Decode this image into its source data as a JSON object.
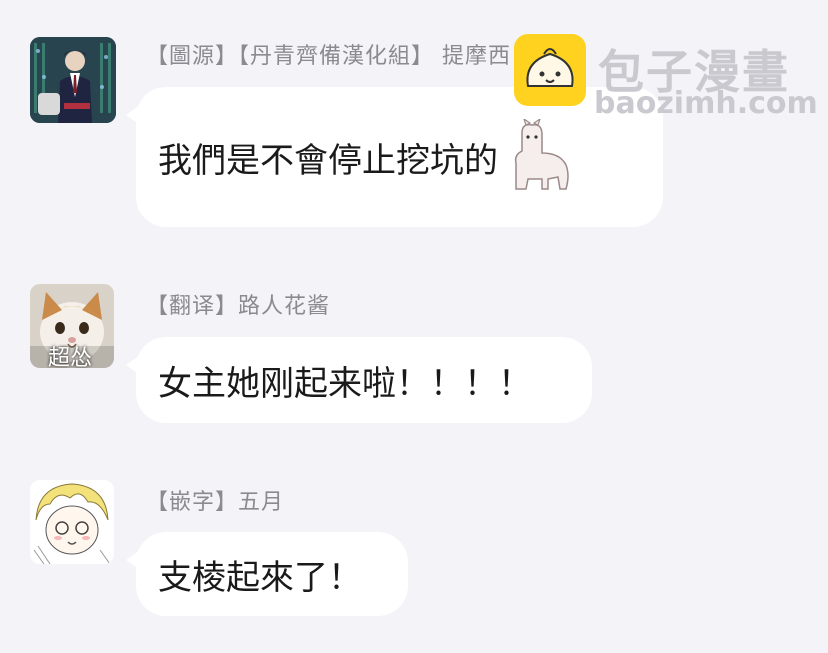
{
  "messages": [
    {
      "sender": "【圖源】【丹青齊備漢化組】 提摩西",
      "text": "我們是不會停止挖坑的",
      "avatar_icon": "anime-character-avatar"
    },
    {
      "sender": "【翻译】路人花酱",
      "text": "女主她刚起来啦！！！！",
      "avatar_caption": "超怂",
      "avatar_icon": "cat-avatar"
    },
    {
      "sender": "【嵌字】五月",
      "text": "支棱起來了！",
      "avatar_icon": "sketch-character-avatar"
    }
  ],
  "watermark": {
    "name": "包子漫畫",
    "url": "baozimh.com",
    "logo_color": "#ffd21f"
  },
  "colors": {
    "background": "#f3f3f8",
    "bubble": "#ffffff",
    "sender": "#8a8a90"
  }
}
